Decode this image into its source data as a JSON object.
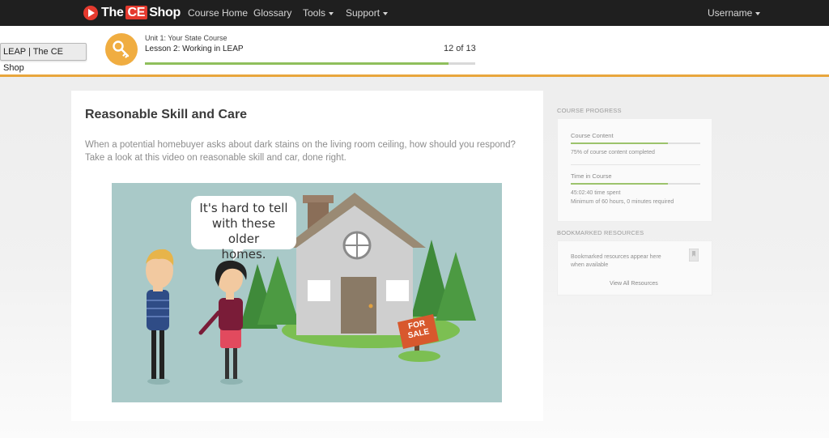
{
  "nav": {
    "brand_pre": "The",
    "brand_ce": "CE",
    "brand_post": "Shop",
    "links": [
      "Course Home",
      "Glossary",
      "Tools",
      "Support"
    ],
    "username": "Username"
  },
  "tooltip": "LEAP | The CE Shop",
  "lesson": {
    "unit": "Unit 1: Your State Course",
    "name": "Lesson 2: Working in LEAP",
    "count": "12 of 13",
    "progress_fraction": 0.92
  },
  "main": {
    "title": "Reasonable Skill and Care",
    "description": "When a potential homebuyer asks about dark stains on the living room ceiling, how should you respond? Take a look at this video on reasonable skill and car, done right.",
    "video": {
      "speech_line1": "It's hard to tell",
      "speech_line2": "with these older",
      "speech_line3": "homes.",
      "sign_line1": "FOR",
      "sign_line2": "SALE"
    }
  },
  "sidebar": {
    "progress_heading": "COURSE PROGRESS",
    "content": {
      "label": "Course Content",
      "detail": "75% of course content completed",
      "fraction": 0.75
    },
    "time": {
      "label": "Time in Course",
      "detail1": "45:02:40 time spent",
      "detail2": "Minimum of 60 hours, 0 minutes required",
      "fraction": 0.75
    },
    "bookmarks_heading": "BOOKMARKED RESOURCES",
    "bookmarks_text1": "Bookmarked resources appear here",
    "bookmarks_text2": "when available",
    "view_all": "View All Resources"
  },
  "colors": {
    "nav_bg": "#1f1f1f",
    "brand_red": "#e53a2e",
    "accent_orange": "#f0ad41",
    "progress_green": "#8fbf5c"
  }
}
